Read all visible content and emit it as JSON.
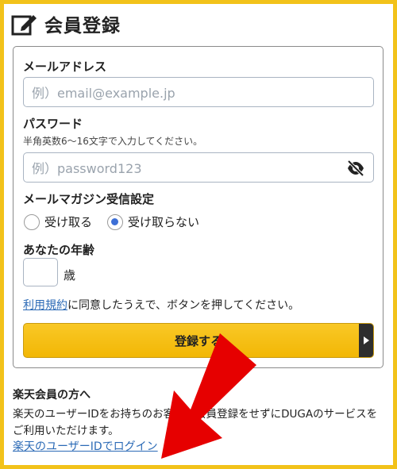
{
  "header": {
    "icon": "edit-icon",
    "title": "会員登録"
  },
  "form": {
    "email": {
      "label": "メールアドレス",
      "placeholder": "例）email@example.jp",
      "value": ""
    },
    "password": {
      "label": "パスワード",
      "hint": "半角英数6〜16文字で入力してください。",
      "placeholder": "例）password123",
      "value": "",
      "toggle_icon": "eye-off-icon"
    },
    "newsletter": {
      "label": "メールマガジン受信設定",
      "options": [
        "受け取る",
        "受け取らない"
      ],
      "selected": "受け取らない"
    },
    "age": {
      "label": "あなたの年齢",
      "value": "",
      "unit": "歳"
    },
    "terms": {
      "link": "利用規約",
      "text": "に同意したうえで、ボタンを押してください。"
    },
    "submit_label": "登録する",
    "submit_icon": "chevron-right-icon"
  },
  "rakuten": {
    "heading": "楽天会員の方へ",
    "body": "楽天のユーザーIDをお持ちのお客様は会員登録をせずにDUGAのサービスをご利用いただけます。",
    "login_link": "楽天のユーザーIDでログイン"
  },
  "annotation": {
    "icon": "red-arrow-icon",
    "color": "#e60000"
  },
  "colors": {
    "accent": "#f2c21a",
    "button": "#f9c826",
    "link": "#2b6ab6",
    "radio_selected": "#3d6fd6"
  }
}
